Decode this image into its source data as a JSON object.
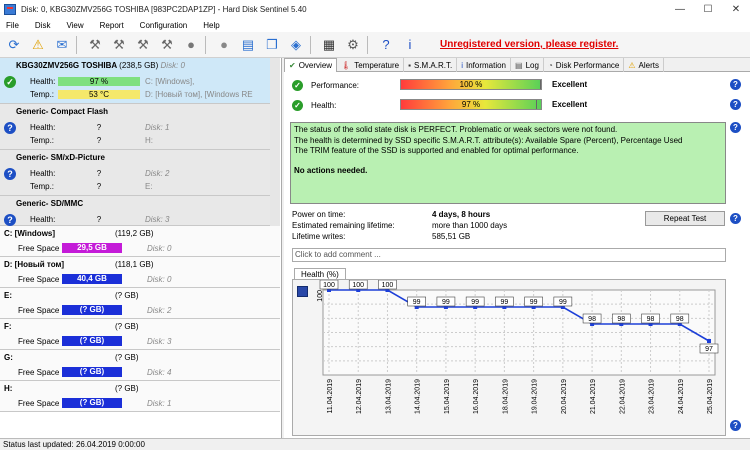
{
  "window": {
    "title": "Disk: 0, KBG30ZMV256G TOSHIBA [983PC2DAP1ZP]  -  Hard Disk Sentinel 5.40"
  },
  "menu": [
    "File",
    "Disk",
    "View",
    "Report",
    "Configuration",
    "Help"
  ],
  "toolbar": {
    "unregistered": "Unregistered version, please register."
  },
  "disks": [
    {
      "name": "KBG30ZMV256G TOSHIBA",
      "size": "(238,5 GB)",
      "disk": "Disk: 0",
      "health_label": "Health:",
      "health": "97 %",
      "temp_label": "Temp.:",
      "temp": "53 °C",
      "part1": "C: [Windows],",
      "part2": "D: [Новый том],   [Windows RE"
    },
    {
      "name": "Generic- Compact Flash",
      "size": "",
      "disk": "",
      "health_label": "Health:",
      "health": "?",
      "temp_label": "Temp.:",
      "temp": "?",
      "part1": "Disk: 1",
      "part2": "H:"
    },
    {
      "name": "Generic- SM/xD-Picture",
      "size": "",
      "disk": "",
      "health_label": "Health:",
      "health": "?",
      "temp_label": "Temp.:",
      "temp": "?",
      "part1": "Disk: 2",
      "part2": "E:"
    },
    {
      "name": "Generic- SD/MMC",
      "size": "",
      "disk": "",
      "health_label": "Health:",
      "health": "?",
      "temp_label": "",
      "temp": "",
      "part1": "Disk: 3",
      "part2": ""
    }
  ],
  "volumes": [
    {
      "name": "C: [Windows]",
      "cap": "(119,2 GB)",
      "free_label": "Free Space",
      "free": "29,5 GB",
      "disk": "Disk: 0",
      "color": "#c41bd8"
    },
    {
      "name": "D: [Новый том]",
      "cap": "(118,1 GB)",
      "free_label": "Free Space",
      "free": "40,4 GB",
      "disk": "Disk: 0",
      "color": "#1b2fd8"
    },
    {
      "name": "E:",
      "cap": "(? GB)",
      "free_label": "Free Space",
      "free": "(? GB)",
      "disk": "Disk: 2",
      "color": "#1b2fd8"
    },
    {
      "name": "F:",
      "cap": "(? GB)",
      "free_label": "Free Space",
      "free": "(? GB)",
      "disk": "Disk: 3",
      "color": "#1b2fd8"
    },
    {
      "name": "G:",
      "cap": "(? GB)",
      "free_label": "Free Space",
      "free": "(? GB)",
      "disk": "Disk: 4",
      "color": "#1b2fd8"
    },
    {
      "name": "H:",
      "cap": "(? GB)",
      "free_label": "Free Space",
      "free": "(? GB)",
      "disk": "Disk: 1",
      "color": "#1b2fd8"
    }
  ],
  "tabs": [
    "Overview",
    "Temperature",
    "S.M.A.R.T.",
    "Information",
    "Log",
    "Disk Performance",
    "Alerts"
  ],
  "overview": {
    "performance_label": "Performance:",
    "performance_value": "100 %",
    "performance_pct": 100,
    "performance_text": "Excellent",
    "health_label": "Health:",
    "health_value": "97 %",
    "health_pct": 97,
    "health_text": "Excellent",
    "status_lines": [
      "The status of the solid state disk is PERFECT. Problematic or weak sectors were not found.",
      "The health is determined by SSD specific S.M.A.R.T. attribute(s):  Available Spare (Percent), Percentage Used",
      "The TRIM feature of the SSD is supported and enabled for optimal performance."
    ],
    "no_actions": "No actions needed.",
    "power_on_label": "Power on time:",
    "power_on_value": "4 days, 8 hours",
    "lifetime_label": "Estimated remaining lifetime:",
    "lifetime_value": "more than 1000 days",
    "writes_label": "Lifetime writes:",
    "writes_value": "585,51 GB",
    "repeat_button": "Repeat Test",
    "comment_placeholder": "Click to add comment ...",
    "health_tab": "Health (%)"
  },
  "chart_data": {
    "type": "line",
    "title": "",
    "ylabel": "",
    "ylim": [
      95,
      100
    ],
    "categories": [
      "11.04.2019",
      "12.04.2019",
      "13.04.2019",
      "14.04.2019",
      "15.04.2019",
      "16.04.2019",
      "18.04.2019",
      "19.04.2019",
      "20.04.2019",
      "21.04.2019",
      "22.04.2019",
      "23.04.2019",
      "24.04.2019",
      "25.04.2019"
    ],
    "series": [
      {
        "values": [
          100,
          100,
          100,
          99,
          99,
          99,
          99,
          99,
          99,
          98,
          98,
          98,
          98,
          97
        ]
      }
    ],
    "labels_shown": [
      "100",
      "100",
      "100",
      "99",
      "99",
      "99",
      "99",
      "99",
      "99",
      "98",
      "98",
      "98",
      "98",
      "97"
    ],
    "y_tick_label": "100"
  },
  "statusbar": {
    "text": "Status last updated: 26.04.2019 0:00:00"
  }
}
